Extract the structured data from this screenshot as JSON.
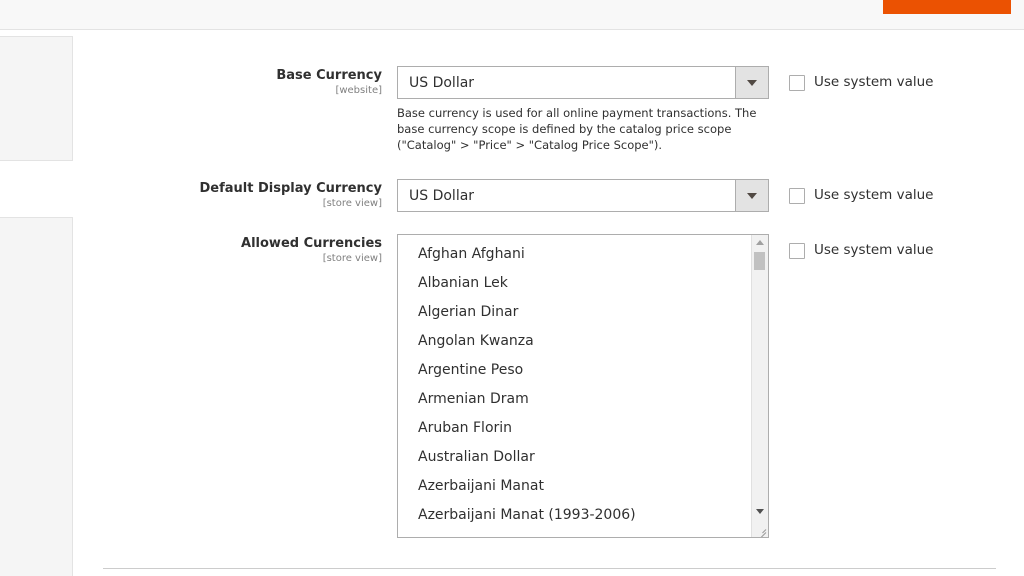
{
  "base_currency": {
    "label": "Base Currency",
    "scope": "[website]",
    "value": "US Dollar",
    "note": "Base currency is used for all online payment transactions. The base currency scope is defined by the catalog price scope (\"Catalog\" > \"Price\" > \"Catalog Price Scope\").",
    "use_system_value": "Use system value"
  },
  "default_display_currency": {
    "label": "Default Display Currency",
    "scope": "[store view]",
    "value": "US Dollar",
    "use_system_value": "Use system value"
  },
  "allowed_currencies": {
    "label": "Allowed Currencies",
    "scope": "[store view]",
    "options": [
      "Afghan Afghani",
      "Albanian Lek",
      "Algerian Dinar",
      "Angolan Kwanza",
      "Argentine Peso",
      "Armenian Dram",
      "Aruban Florin",
      "Australian Dollar",
      "Azerbaijani Manat",
      "Azerbaijani Manat (1993-2006)"
    ],
    "use_system_value": "Use system value"
  },
  "colors": {
    "accent": "#eb5202"
  }
}
